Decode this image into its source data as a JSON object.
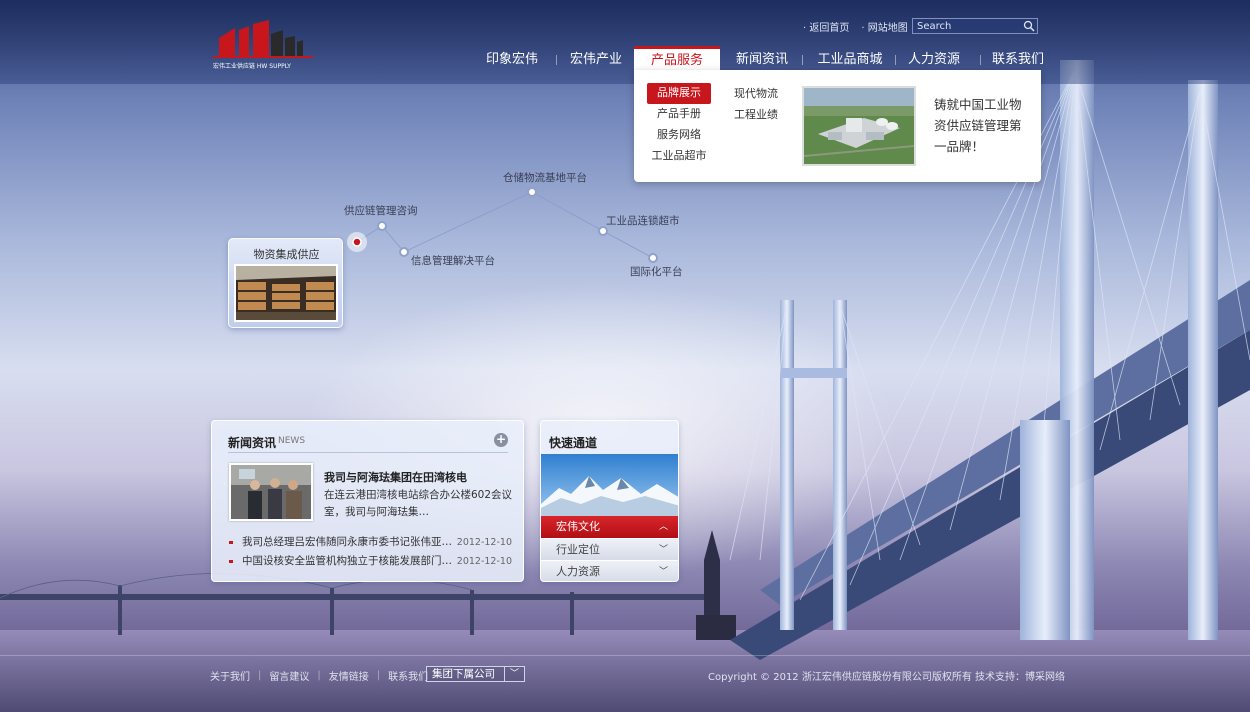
{
  "brand": {
    "logo_text": "宏伟工业供应链 HW SUPPLY",
    "accent_color": "#c8161d"
  },
  "top_links": [
    "返回首页",
    "网站地图"
  ],
  "search": {
    "placeholder": "Search",
    "icon": "search-icon"
  },
  "nav": {
    "items": [
      "印象宏伟",
      "宏伟产业",
      "产品服务",
      "新闻资讯",
      "工业品商城",
      "人力资源",
      "联系我们"
    ],
    "active": "产品服务"
  },
  "dropdown": {
    "col1": [
      "品牌展示",
      "产品手册",
      "服务网络",
      "工业品超市"
    ],
    "col2": [
      "现代物流",
      "工程业绩"
    ],
    "selected": "品牌展示",
    "slogan": "铸就中国工业物资供应链管理第一品牌！"
  },
  "diagram": {
    "hub": "物资集成供应",
    "nodes": [
      "供应链管理咨询",
      "信息管理解决平台",
      "仓储物流基地平台",
      "工业品连锁超市",
      "国际化平台"
    ]
  },
  "news": {
    "title": "新闻资讯",
    "title_en": "NEWS",
    "featured_headline": "我司与阿海珐集团在田湾核电",
    "featured_summary": "在连云港田湾核电站综合办公楼602会议室，我司与阿海珐集…",
    "items": [
      {
        "text": "我司总经理吕宏伟随同永康市委书记张伟亚…",
        "date": "2012-12-10"
      },
      {
        "text": "中国设核安全监管机构独立于核能发展部门…",
        "date": "2012-12-10"
      }
    ]
  },
  "quick": {
    "title": "快速通道",
    "items": [
      {
        "label": "宏伟文化",
        "chev": "︿"
      },
      {
        "label": "行业定位",
        "chev": "﹀"
      },
      {
        "label": "人力资源",
        "chev": "﹀"
      }
    ]
  },
  "footer": {
    "links": [
      "关于我们",
      "留言建议",
      "友情链接",
      "联系我们"
    ],
    "group_select": "集团下属公司",
    "copyright": "Copyright © 2012 浙江宏伟供应链股份有限公司版权所有  技术支持：博采网络"
  }
}
